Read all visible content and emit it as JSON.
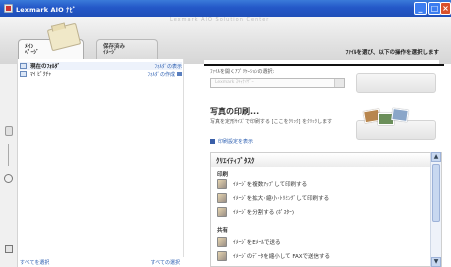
{
  "window": {
    "title": "Lexmark AIO ﾅﾋﾞ",
    "min_label": "_",
    "max_label": "□",
    "close_label": "×"
  },
  "header": {
    "brand_faint": "Lexmark AIO Solution Center",
    "instruction": "ﾌｧｲﾙを選び、以下の操作を選択します",
    "tabs": [
      {
        "label_line1": "ﾒｲﾝ",
        "label_line2": "ﾍﾟｰｼﾞ"
      },
      {
        "label_line1": "保存済み",
        "label_line2": "ｲﾒｰｼﾞ"
      }
    ]
  },
  "left": {
    "rows": [
      {
        "label": "現在のﾌｫﾙﾀﾞ",
        "action": "ﾌｫﾙﾀﾞの表示"
      },
      {
        "label": "ﾏｲ ﾋﾟｸﾁｬ",
        "action": "ﾌｫﾙﾀﾞの作成"
      }
    ],
    "select_all": "すべてを選択",
    "deselect_all": "すべての選択"
  },
  "right": {
    "program_label": "ﾌｧｲﾙを開くｱﾌﾟﾘｹｰｼｮﾝの選択:",
    "program_value": "Lexmark ｽｷｬﾅｲｻﾞｰ",
    "print_title": "写真の印刷...",
    "print_desc": "写真を定形ｻｲｽﾞで印刷する [ここをｸﾘｯｸ] をｸﾘｯｸします",
    "print_link": "印刷設定を表示",
    "creative_title": "ｸﾘｴｲﾃｨﾌﾞﾀｽｸ",
    "group_print": "印刷",
    "group_share": "共有",
    "items": [
      "ｲﾒｰｼﾞを複数ｱｯﾌﾟして印刷する",
      "ｲﾒｰｼﾞを拡大･縮小･ﾄﾘﾐﾝｸﾞして印刷する",
      "ｲﾒｰｼﾞを分割する (ﾎﾟｽﾀｰ)",
      "ｲﾒｰｼﾞをEﾒｰﾙで送る",
      "ｲﾒｰｼﾞのﾃﾞｰﾀを縮小して FAXで送信する"
    ]
  }
}
